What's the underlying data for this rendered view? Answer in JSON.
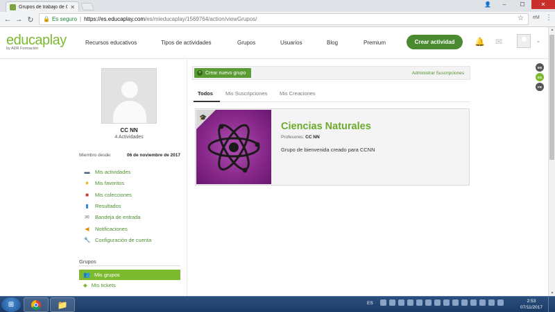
{
  "browser": {
    "tab_title": "Grupos de trabajo de CC",
    "secure_label": "Es seguro",
    "url_host": "https://es.educaplay.com",
    "url_path": "/es/mieducaplay/1569764/action/viewGrupos/",
    "ext_label": "eM"
  },
  "header": {
    "logo_main": "educa",
    "logo_play": "play",
    "logo_sub": "by ADR Formación",
    "nav": [
      "Recursos educativos",
      "Tipos de actividades",
      "Grupos",
      "Usuarios",
      "Blog",
      "Premium"
    ],
    "cta": "Crear actividad"
  },
  "languages": [
    {
      "code": "EN",
      "color": "#555555"
    },
    {
      "code": "ES",
      "color": "#7db92f"
    },
    {
      "code": "FR",
      "color": "#555555"
    }
  ],
  "profile": {
    "name": "CC NN",
    "activities": "4 Actividades",
    "member_since_label": "Miembro desde:",
    "member_since_value": "06 de noviembre de 2017"
  },
  "sidebar": {
    "items": [
      {
        "label": "Mis actividades",
        "icon": "activities-icon"
      },
      {
        "label": "Mis favoritos",
        "icon": "star-icon"
      },
      {
        "label": "Mis colecciones",
        "icon": "collection-icon"
      },
      {
        "label": "Resultados",
        "icon": "chart-icon"
      },
      {
        "label": "Bandeja de entrada",
        "icon": "inbox-icon"
      },
      {
        "label": "Notificaciones",
        "icon": "megaphone-icon"
      },
      {
        "label": "Configuración de cuenta",
        "icon": "wrench-icon"
      }
    ],
    "groups_heading": "Grupos",
    "group_items": [
      {
        "label": "Mis grupos",
        "icon": "group-icon",
        "active": true
      },
      {
        "label": "Mis tickets",
        "icon": "ticket-icon",
        "active": false
      }
    ]
  },
  "main": {
    "new_group": "Crear nuevo grupo",
    "manage_subs": "Administrar Suscripciones",
    "tabs": [
      "Todos",
      "Mis Suscripciones",
      "Mis Creaciones"
    ],
    "card": {
      "title": "Ciencias Naturales",
      "teachers_label": "Profesores:",
      "teachers_value": "CC NN",
      "description": "Grupo de bienvenida creado para CCNN"
    }
  },
  "taskbar": {
    "lang": "ES",
    "time": "2:53",
    "date": "07/11/2017"
  }
}
